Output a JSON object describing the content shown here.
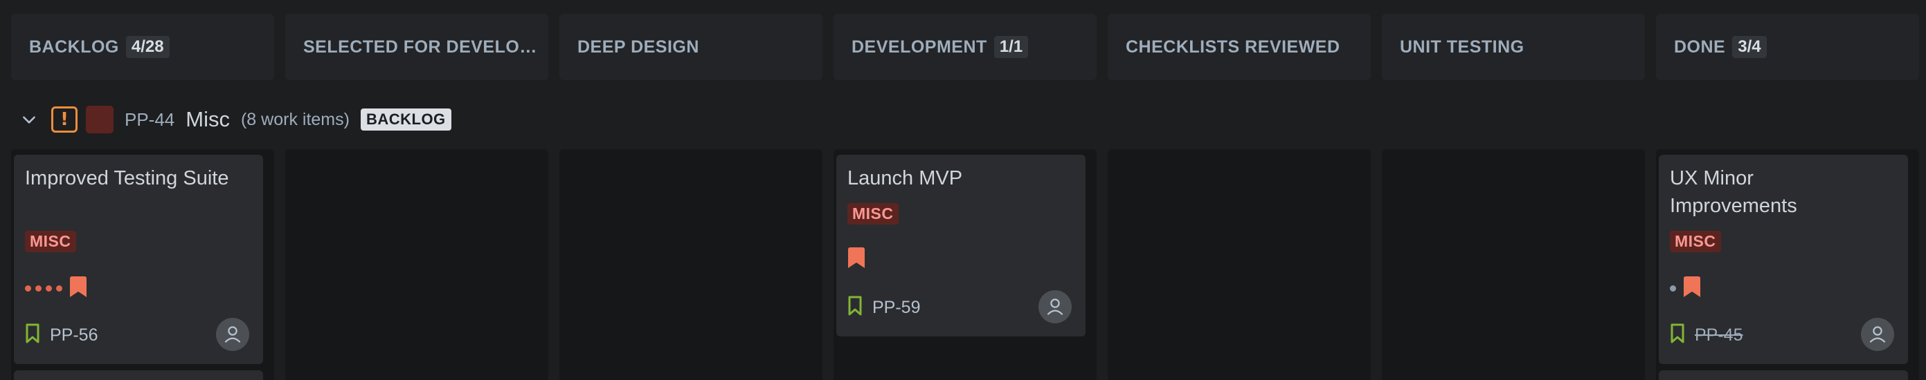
{
  "columns": [
    {
      "title": "BACKLOG",
      "count": "4/28"
    },
    {
      "title": "SELECTED FOR DEVELOPMENT",
      "count": null
    },
    {
      "title": "DEEP DESIGN",
      "count": null
    },
    {
      "title": "DEVELOPMENT",
      "count": "1/1"
    },
    {
      "title": "CHECKLISTS REVIEWED",
      "count": null
    },
    {
      "title": "UNIT TESTING",
      "count": null
    },
    {
      "title": "DONE",
      "count": "3/4"
    }
  ],
  "swimlane": {
    "key": "PP-44",
    "name": "Misc",
    "count_text": "(8 work items)",
    "status": "BACKLOG",
    "priority_symbol": "!",
    "priority_color": "#f18d3b",
    "epic_color": "#5c2420"
  },
  "cards": [
    {
      "title": "Improved Testing Suite",
      "epic": "MISC",
      "key": "PP-56",
      "done": false,
      "estimate_dots": 4,
      "type_icon": "bookmark-icon"
    },
    {
      "title": "Launch MVP",
      "epic": "MISC",
      "key": "PP-59",
      "done": false,
      "estimate_dots": 0,
      "type_icon": "bookmark-icon"
    },
    {
      "title": "UX Minor Improvements",
      "epic": "MISC",
      "key": "PP-45",
      "done": true,
      "estimate_dots": 1,
      "type_icon": "bookmark-icon"
    }
  ],
  "colors": {
    "background": "#1d1e20",
    "column_header": "#222427",
    "card": "#2b2c2f",
    "priority_flag": "#f07558",
    "story_icon": "#82b536"
  }
}
